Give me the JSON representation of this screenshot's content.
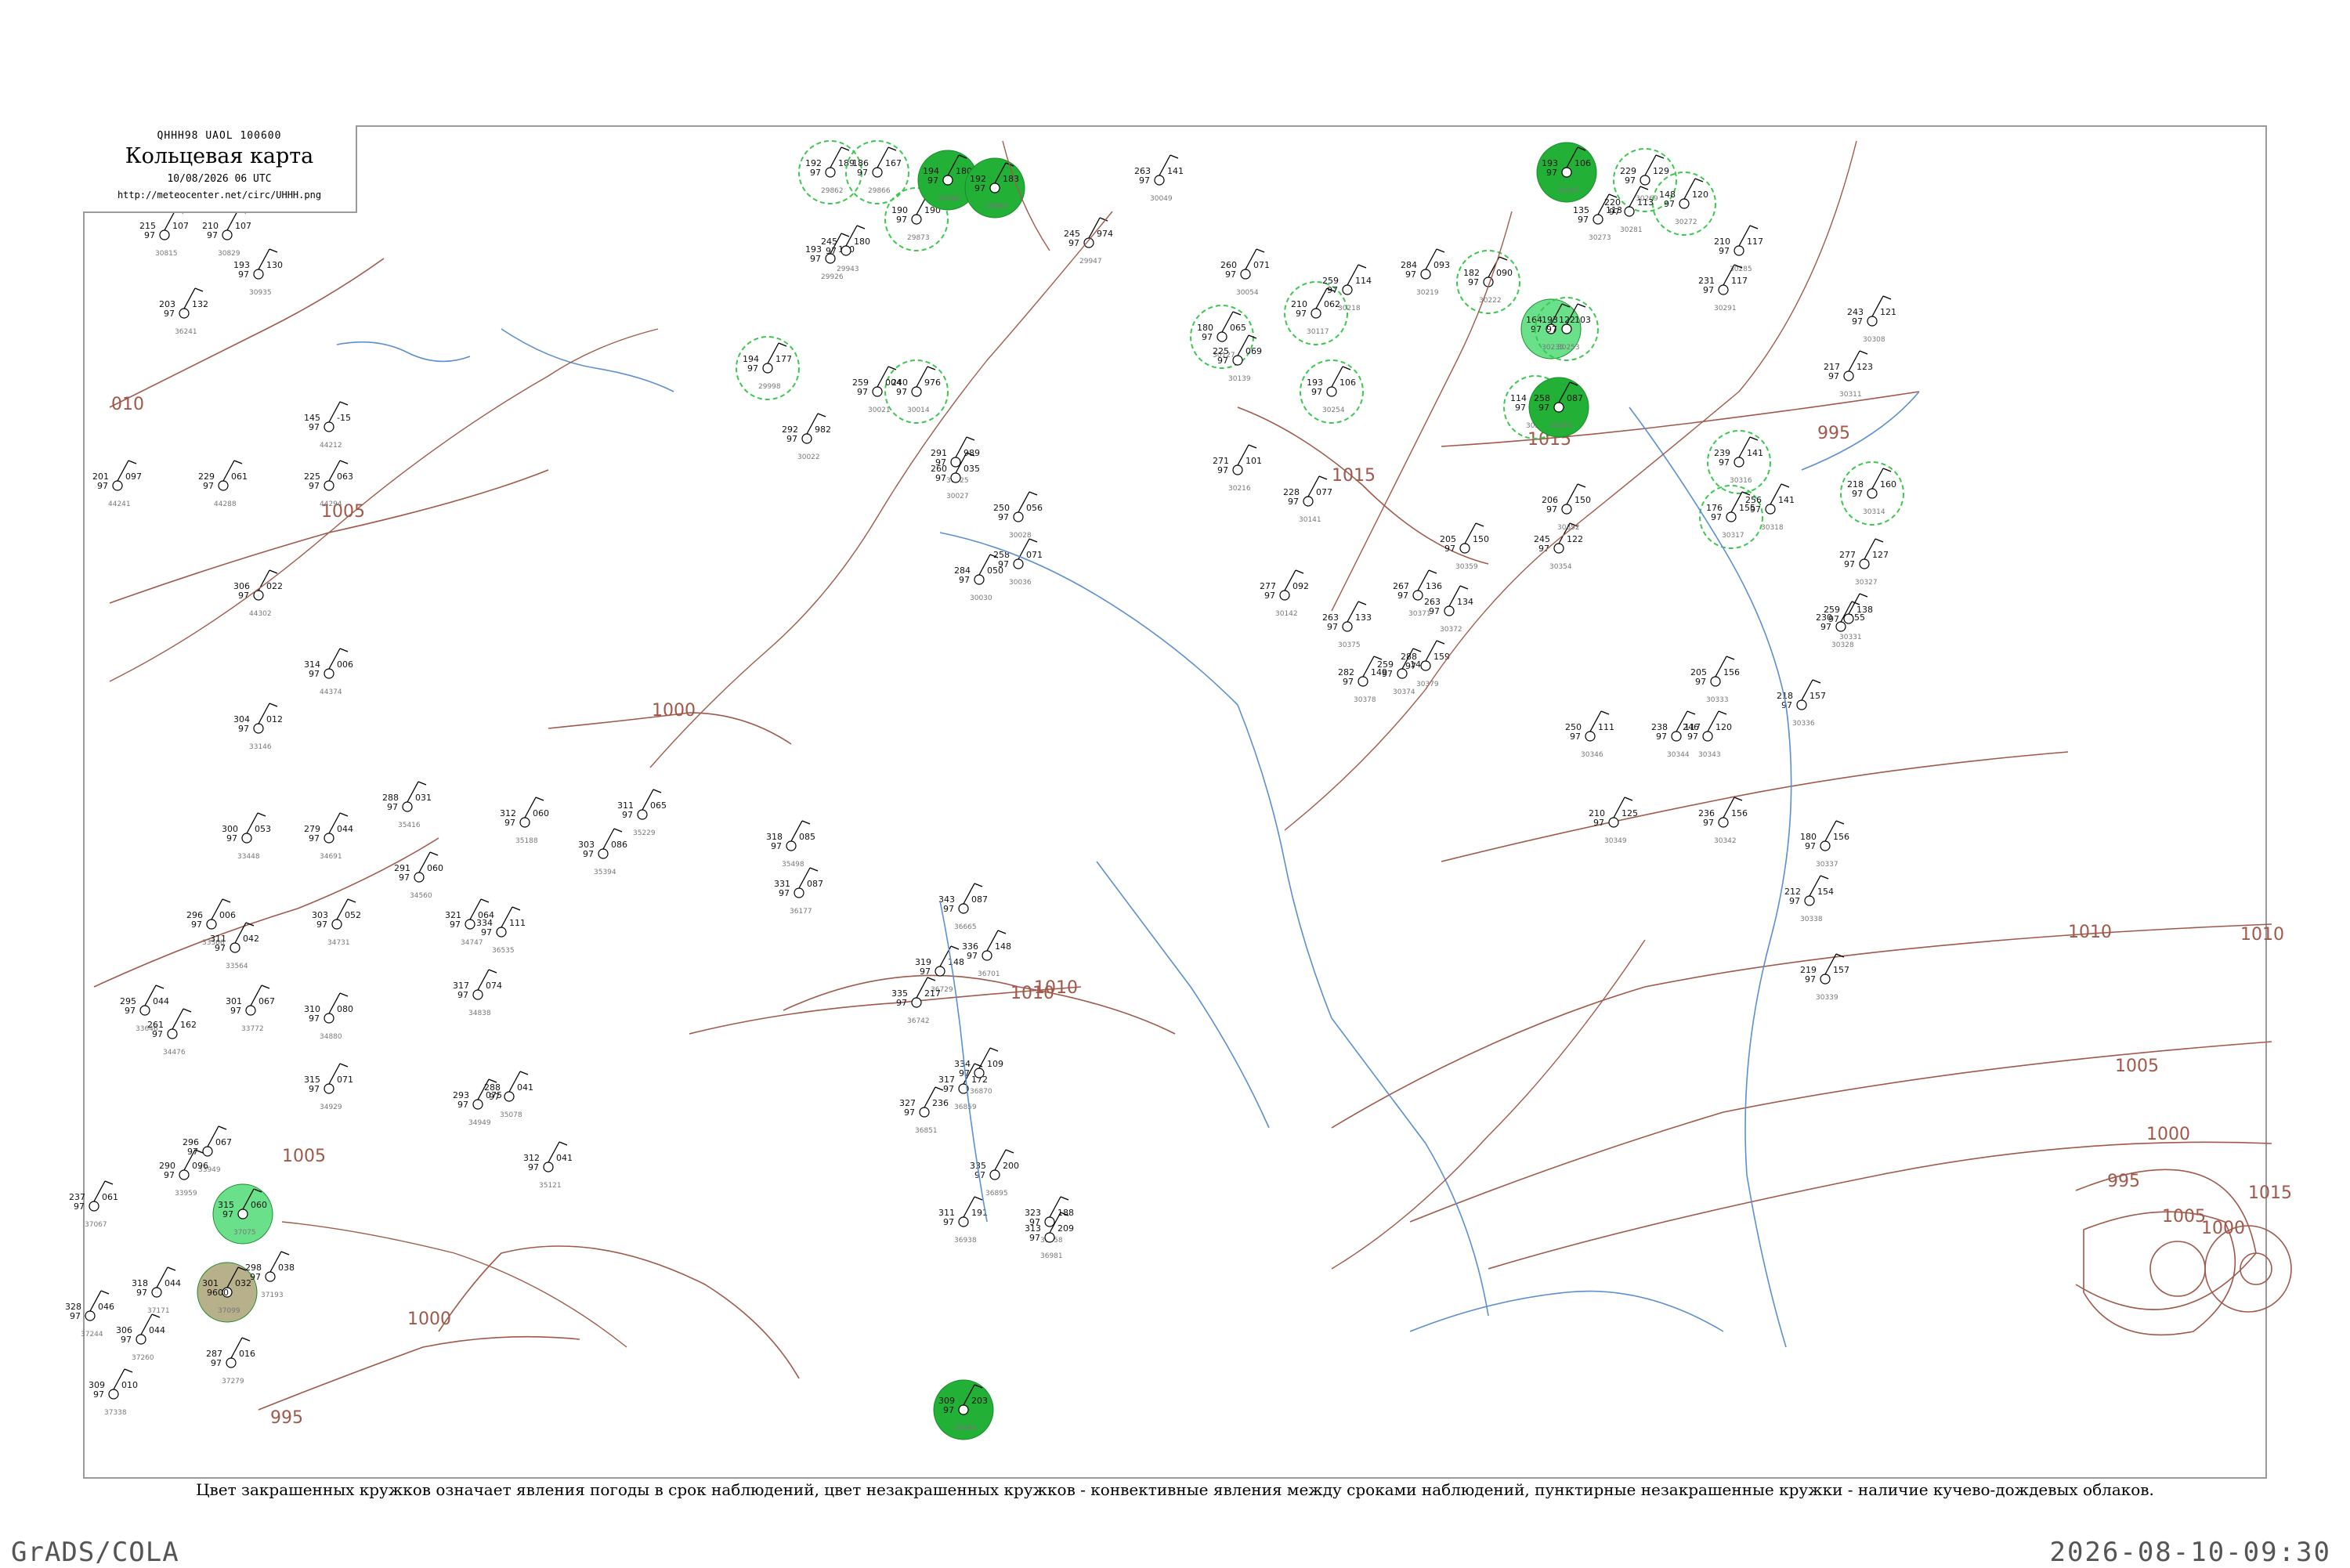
{
  "header": {
    "code": "QHHH98  UAOL  100600",
    "title": "Кольцевая карта",
    "datetime": "10/08/2026 06 UTC",
    "url": "http://meteocenter.net/circ/UHHH.png"
  },
  "caption": "Цвет закрашенных кружков означает явления погоды в срок наблюдений, цвет незакрашенных кружков - конвективные явления между сроками наблюдений, пунктирные незакрашенные кружки - наличие кучево-дождевых облаков.",
  "footer": {
    "left": "GrADS/COLA",
    "right": "2026-08-10-09:30"
  },
  "colors": {
    "isobar": "#a0584a",
    "river": "#5b8fd0",
    "border": "#b0b0b0",
    "frame": "#9a9a9a",
    "weather_green": "#22b036",
    "weather_light_green": "#6be08a",
    "weather_olive": "#b7b08a",
    "cb_dashed": "#3cc84f"
  },
  "isobars": [
    {
      "label": "1015"
    },
    {
      "label": "1010"
    },
    {
      "label": "1005"
    },
    {
      "label": "1000"
    },
    {
      "label": "995"
    },
    {
      "label": "1010"
    },
    {
      "label": "1005"
    },
    {
      "label": "1000"
    },
    {
      "label": "995"
    },
    {
      "label": "010"
    },
    {
      "label": "1005"
    },
    {
      "label": "1000"
    },
    {
      "label": "1015"
    },
    {
      "label": "1010"
    },
    {
      "label": "1005"
    },
    {
      "label": "1000"
    },
    {
      "label": "995"
    },
    {
      "label": "1015"
    },
    {
      "label": "1010"
    }
  ],
  "stations": [
    {
      "id": "30815",
      "t": "215",
      "p": "97",
      "dp": "107",
      "weather": "none"
    },
    {
      "id": "30829",
      "t": "210",
      "p": "97",
      "dp": "107",
      "weather": "none"
    },
    {
      "id": "30935",
      "t": "193",
      "p": "97",
      "dp": "130",
      "weather": "none"
    },
    {
      "id": "36241",
      "t": "203",
      "p": "97",
      "dp": "132",
      "weather": "none"
    },
    {
      "id": "44212",
      "t": "145",
      "p": "97",
      "dp": "-15",
      "weather": "none"
    },
    {
      "id": "44241",
      "t": "201",
      "p": "97",
      "dp": "097",
      "weather": "none"
    },
    {
      "id": "44288",
      "t": "229",
      "p": "97",
      "dp": "061",
      "weather": "none"
    },
    {
      "id": "44294",
      "t": "225",
      "p": "97",
      "dp": "063",
      "weather": "none"
    },
    {
      "id": "44302",
      "t": "306",
      "p": "97",
      "dp": "022",
      "weather": "none"
    },
    {
      "id": "44374",
      "t": "314",
      "p": "97",
      "dp": "006",
      "weather": "none"
    },
    {
      "id": "33146",
      "t": "304",
      "p": "97",
      "dp": "012",
      "weather": "none"
    },
    {
      "id": "33366",
      "t": "296",
      "p": "97",
      "dp": "006",
      "weather": "none"
    },
    {
      "id": "33448",
      "t": "300",
      "p": "97",
      "dp": "053",
      "weather": "none"
    },
    {
      "id": "33564",
      "t": "311",
      "p": "97",
      "dp": "042",
      "weather": "none"
    },
    {
      "id": "33646",
      "t": "295",
      "p": "97",
      "dp": "044",
      "weather": "none"
    },
    {
      "id": "33772",
      "t": "301",
      "p": "97",
      "dp": "067",
      "weather": "none"
    },
    {
      "id": "34476",
      "t": "261",
      "p": "97",
      "dp": "162",
      "weather": "none"
    },
    {
      "id": "33949",
      "t": "296",
      "p": "97",
      "dp": "067",
      "weather": "none"
    },
    {
      "id": "33959",
      "t": "290",
      "p": "97",
      "dp": "096",
      "weather": "none"
    },
    {
      "id": "37067",
      "t": "237",
      "p": "97",
      "dp": "061",
      "weather": "none"
    },
    {
      "id": "37075",
      "t": "315",
      "p": "97",
      "dp": "060",
      "weather": "light_green"
    },
    {
      "id": "37099",
      "t": "301",
      "p": "9600",
      "dp": "032",
      "weather": "olive"
    },
    {
      "id": "37193",
      "t": "298",
      "p": "97",
      "dp": "038",
      "weather": "none"
    },
    {
      "id": "37244",
      "t": "328",
      "p": "97",
      "dp": "046",
      "weather": "none"
    },
    {
      "id": "37260",
      "t": "306",
      "p": "97",
      "dp": "044",
      "weather": "none"
    },
    {
      "id": "37338",
      "t": "309",
      "p": "97",
      "dp": "010",
      "weather": "none"
    },
    {
      "id": "37171",
      "t": "318",
      "p": "97",
      "dp": "044",
      "weather": "none"
    },
    {
      "id": "37279",
      "t": "287",
      "p": "97",
      "dp": "016",
      "weather": "none"
    },
    {
      "id": "35416",
      "t": "288",
      "p": "97",
      "dp": "031",
      "weather": "none"
    },
    {
      "id": "34691",
      "t": "279",
      "p": "97",
      "dp": "044",
      "weather": "none"
    },
    {
      "id": "34560",
      "t": "291",
      "p": "97",
      "dp": "060",
      "weather": "none"
    },
    {
      "id": "34731",
      "t": "303",
      "p": "97",
      "dp": "052",
      "weather": "none"
    },
    {
      "id": "34747",
      "t": "321",
      "p": "97",
      "dp": "064",
      "weather": "none"
    },
    {
      "id": "34838",
      "t": "317",
      "p": "97",
      "dp": "074",
      "weather": "none"
    },
    {
      "id": "34880",
      "t": "310",
      "p": "97",
      "dp": "080",
      "weather": "none"
    },
    {
      "id": "34929",
      "t": "315",
      "p": "97",
      "dp": "071",
      "weather": "none"
    },
    {
      "id": "34949",
      "t": "293",
      "p": "97",
      "dp": "075",
      "weather": "none"
    },
    {
      "id": "35078",
      "t": "288",
      "p": "97",
      "dp": "041",
      "weather": "none"
    },
    {
      "id": "35121",
      "t": "312",
      "p": "97",
      "dp": "041",
      "weather": "none"
    },
    {
      "id": "35188",
      "t": "312",
      "p": "97",
      "dp": "060",
      "weather": "none"
    },
    {
      "id": "35229",
      "t": "311",
      "p": "97",
      "dp": "065",
      "weather": "none"
    },
    {
      "id": "35394",
      "t": "303",
      "p": "97",
      "dp": "086",
      "weather": "none"
    },
    {
      "id": "35498",
      "t": "318",
      "p": "97",
      "dp": "085",
      "weather": "none"
    },
    {
      "id": "36177",
      "t": "331",
      "p": "97",
      "dp": "087",
      "weather": "none"
    },
    {
      "id": "36535",
      "t": "334",
      "p": "97",
      "dp": "111",
      "weather": "none"
    },
    {
      "id": "36665",
      "t": "343",
      "p": "97",
      "dp": "087",
      "weather": "none"
    },
    {
      "id": "36701",
      "t": "336",
      "p": "97",
      "dp": "148",
      "weather": "none"
    },
    {
      "id": "36729",
      "t": "319",
      "p": "97",
      "dp": "148",
      "weather": "none"
    },
    {
      "id": "36742",
      "t": "335",
      "p": "97",
      "dp": "217",
      "weather": "none"
    },
    {
      "id": "36851",
      "t": "327",
      "p": "97",
      "dp": "236",
      "weather": "none"
    },
    {
      "id": "36859",
      "t": "317",
      "p": "97",
      "dp": "172",
      "weather": "none"
    },
    {
      "id": "36870",
      "t": "334",
      "p": "97",
      "dp": "109",
      "weather": "none"
    },
    {
      "id": "36895",
      "t": "335",
      "p": "97",
      "dp": "200",
      "weather": "none"
    },
    {
      "id": "36938",
      "t": "311",
      "p": "97",
      "dp": "191",
      "weather": "none"
    },
    {
      "id": "36958",
      "t": "323",
      "p": "97",
      "dp": "188",
      "weather": "none"
    },
    {
      "id": "36981",
      "t": "313",
      "p": "97",
      "dp": "209",
      "weather": "none"
    },
    {
      "id": "36989",
      "t": "309",
      "p": "97",
      "dp": "203",
      "weather": "green"
    },
    {
      "id": "29862",
      "t": "192",
      "p": "97",
      "dp": "189",
      "weather": "cb"
    },
    {
      "id": "29866",
      "t": "186",
      "p": "97",
      "dp": "167",
      "weather": "cb"
    },
    {
      "id": "29873",
      "t": "190",
      "p": "97",
      "dp": "190",
      "weather": "cb"
    },
    {
      "id": "29882",
      "t": "194",
      "p": "97",
      "dp": "180",
      "weather": "green"
    },
    {
      "id": "29889",
      "t": "192",
      "p": "97",
      "dp": "183",
      "weather": "green"
    },
    {
      "id": "29926",
      "t": "193",
      "p": "97",
      "dp": "130",
      "weather": "none"
    },
    {
      "id": "29943",
      "t": "245",
      "p": "97",
      "dp": "180",
      "weather": "none"
    },
    {
      "id": "29947",
      "t": "245",
      "p": "97",
      "dp": "974",
      "weather": "none"
    },
    {
      "id": "29998",
      "t": "194",
      "p": "97",
      "dp": "177",
      "weather": "cb"
    },
    {
      "id": "30014",
      "t": "240",
      "p": "97",
      "dp": "976",
      "weather": "cb"
    },
    {
      "id": "30021",
      "t": "259",
      "p": "97",
      "dp": "004",
      "weather": "none"
    },
    {
      "id": "30022",
      "t": "292",
      "p": "97",
      "dp": "982",
      "weather": "none"
    },
    {
      "id": "30025",
      "t": "291",
      "p": "97",
      "dp": "989",
      "weather": "none"
    },
    {
      "id": "30027",
      "t": "260",
      "p": "97",
      "dp": "035",
      "weather": "none"
    },
    {
      "id": "30028",
      "t": "250",
      "p": "97",
      "dp": "056",
      "weather": "none"
    },
    {
      "id": "30030",
      "t": "284",
      "p": "97",
      "dp": "050",
      "weather": "none"
    },
    {
      "id": "30036",
      "t": "258",
      "p": "97",
      "dp": "071",
      "weather": "none"
    },
    {
      "id": "30049",
      "t": "263",
      "p": "97",
      "dp": "141",
      "weather": "none"
    },
    {
      "id": "30054",
      "t": "260",
      "p": "97",
      "dp": "071",
      "weather": "none"
    },
    {
      "id": "30117",
      "t": "210",
      "p": "97",
      "dp": "062",
      "weather": "cb"
    },
    {
      "id": "30127",
      "t": "180",
      "p": "97",
      "dp": "065",
      "weather": "cb"
    },
    {
      "id": "30139",
      "t": "225",
      "p": "97",
      "dp": "069",
      "weather": "none"
    },
    {
      "id": "30141",
      "t": "228",
      "p": "97",
      "dp": "077",
      "weather": "none"
    },
    {
      "id": "30142",
      "t": "277",
      "p": "97",
      "dp": "092",
      "weather": "none"
    },
    {
      "id": "30216",
      "t": "271",
      "p": "97",
      "dp": "101",
      "weather": "none"
    },
    {
      "id": "30218",
      "t": "259",
      "p": "97",
      "dp": "114",
      "weather": "none"
    },
    {
      "id": "30219",
      "t": "284",
      "p": "97",
      "dp": "093",
      "weather": "none"
    },
    {
      "id": "30222",
      "t": "182",
      "p": "97",
      "dp": "090",
      "weather": "cb"
    },
    {
      "id": "30235",
      "t": "164",
      "p": "97",
      "dp": "122",
      "weather": "light_green"
    },
    {
      "id": "30253",
      "t": "193",
      "p": "97",
      "dp": "103",
      "weather": "cb"
    },
    {
      "id": "30254",
      "t": "193",
      "p": "97",
      "dp": "106",
      "weather": "cb"
    },
    {
      "id": "30258",
      "t": "114",
      "p": "97",
      "dp": "106",
      "weather": "cb"
    },
    {
      "id": "30263",
      "t": "258",
      "p": "97",
      "dp": "087",
      "weather": "green"
    },
    {
      "id": "30267",
      "t": "193",
      "p": "97",
      "dp": "106",
      "weather": "green"
    },
    {
      "id": "30269",
      "t": "229",
      "p": "97",
      "dp": "129",
      "weather": "cb"
    },
    {
      "id": "30272",
      "t": "148",
      "p": "97",
      "dp": "120",
      "weather": "cb"
    },
    {
      "id": "30273",
      "t": "135",
      "p": "97",
      "dp": "113",
      "weather": "none"
    },
    {
      "id": "30281",
      "t": "220",
      "p": "97",
      "dp": "113",
      "weather": "none"
    },
    {
      "id": "30285",
      "t": "210",
      "p": "97",
      "dp": "117",
      "weather": "none"
    },
    {
      "id": "30291",
      "t": "231",
      "p": "97",
      "dp": "117",
      "weather": "none"
    },
    {
      "id": "30308",
      "t": "243",
      "p": "97",
      "dp": "121",
      "weather": "none"
    },
    {
      "id": "30311",
      "t": "217",
      "p": "97",
      "dp": "123",
      "weather": "none"
    },
    {
      "id": "30314",
      "t": "218",
      "p": "97",
      "dp": "160",
      "weather": "cb"
    },
    {
      "id": "30316",
      "t": "239",
      "p": "97",
      "dp": "141",
      "weather": "cb"
    },
    {
      "id": "30317",
      "t": "176",
      "p": "97",
      "dp": "155",
      "weather": "cb"
    },
    {
      "id": "30318",
      "t": "256",
      "p": "97",
      "dp": "141",
      "weather": "none"
    },
    {
      "id": "30327",
      "t": "277",
      "p": "97",
      "dp": "127",
      "weather": "none"
    },
    {
      "id": "30328",
      "t": "230",
      "p": "97",
      "dp": "155",
      "weather": "none"
    },
    {
      "id": "30331",
      "t": "259",
      "p": "97",
      "dp": "138",
      "weather": "none"
    },
    {
      "id": "30333",
      "t": "205",
      "p": "97",
      "dp": "156",
      "weather": "none"
    },
    {
      "id": "30336",
      "t": "218",
      "p": "97",
      "dp": "157",
      "weather": "none"
    },
    {
      "id": "30337",
      "t": "180",
      "p": "97",
      "dp": "156",
      "weather": "none"
    },
    {
      "id": "30338",
      "t": "212",
      "p": "97",
      "dp": "154",
      "weather": "none"
    },
    {
      "id": "30339",
      "t": "219",
      "p": "97",
      "dp": "157",
      "weather": "none"
    },
    {
      "id": "30342",
      "t": "236",
      "p": "97",
      "dp": "156",
      "weather": "none"
    },
    {
      "id": "30343",
      "t": "246",
      "p": "97",
      "dp": "120",
      "weather": "none"
    },
    {
      "id": "30344",
      "t": "238",
      "p": "97",
      "dp": "117",
      "weather": "none"
    },
    {
      "id": "30346",
      "t": "250",
      "p": "97",
      "dp": "111",
      "weather": "none"
    },
    {
      "id": "30349",
      "t": "210",
      "p": "97",
      "dp": "125",
      "weather": "none"
    },
    {
      "id": "30352",
      "t": "206",
      "p": "97",
      "dp": "150",
      "weather": "none"
    },
    {
      "id": "30354",
      "t": "245",
      "p": "97",
      "dp": "122",
      "weather": "none"
    },
    {
      "id": "30359",
      "t": "205",
      "p": "97",
      "dp": "150",
      "weather": "none"
    },
    {
      "id": "30371",
      "t": "267",
      "p": "97",
      "dp": "136",
      "weather": "none"
    },
    {
      "id": "30372",
      "t": "263",
      "p": "97",
      "dp": "134",
      "weather": "none"
    },
    {
      "id": "30374",
      "t": "259",
      "p": "97",
      "dp": "140",
      "weather": "none"
    },
    {
      "id": "30375",
      "t": "263",
      "p": "97",
      "dp": "133",
      "weather": "none"
    },
    {
      "id": "30378",
      "t": "282",
      "p": "97",
      "dp": "149",
      "weather": "none"
    },
    {
      "id": "30379",
      "t": "288",
      "p": "97",
      "dp": "159",
      "weather": "none"
    }
  ]
}
